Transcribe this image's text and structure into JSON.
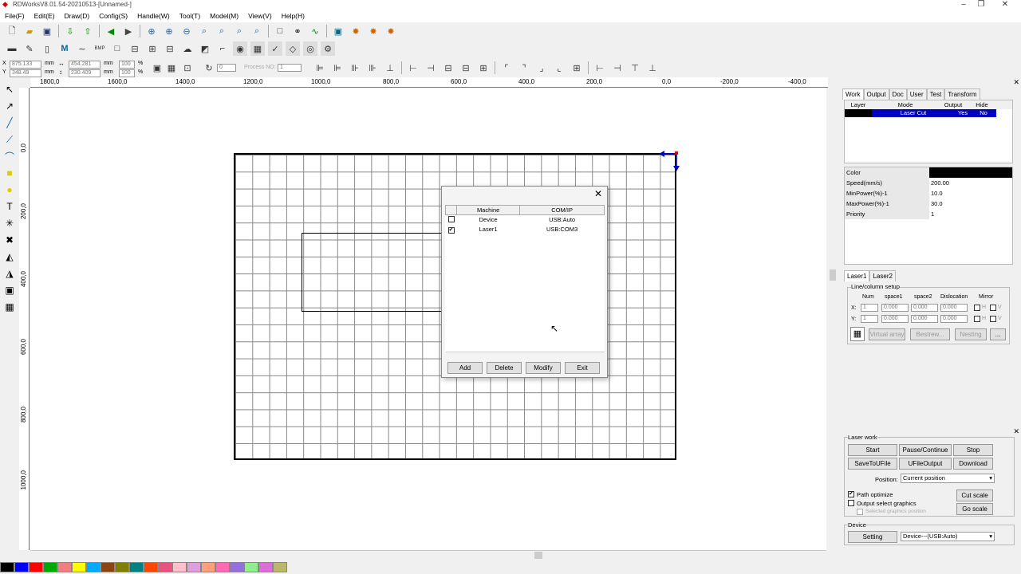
{
  "window": {
    "title": "RDWorksV8.01.54-20210513-[Unnamed-]"
  },
  "menu": [
    "File(F)",
    "Edit(E)",
    "Draw(D)",
    "Config(S)",
    "Handle(W)",
    "Tool(T)",
    "Model(M)",
    "View(V)",
    "Help(H)"
  ],
  "coords": {
    "x": "875.133",
    "y": "348.49",
    "w": "454.281",
    "h": "230.409",
    "unit": "mm",
    "sx": "100",
    "sy": "100",
    "pct": "%",
    "rot": "0",
    "process_label": "Process NO:",
    "process_no": "1"
  },
  "hruler": [
    "1800,0",
    "1600,0",
    "1400,0",
    "1200,0",
    "1000,0",
    "800,0",
    "600,0",
    "400,0",
    "200,0",
    "0,0",
    "-200,0",
    "-400,0"
  ],
  "vruler": [
    "0,0",
    "200,0",
    "400,0",
    "600,0",
    "800,0",
    "1000,0"
  ],
  "dialog": {
    "headers": [
      "Machine",
      "COM/IP"
    ],
    "rows": [
      {
        "checked": false,
        "machine": "Device",
        "comip": "USB:Auto"
      },
      {
        "checked": true,
        "machine": "Laser1",
        "comip": "USB:COM3"
      }
    ],
    "buttons": [
      "Add",
      "Delete",
      "Modify",
      "Exit"
    ],
    "check_mark": "✔"
  },
  "right": {
    "tabs": [
      "Work",
      "Output",
      "Doc",
      "User",
      "Test",
      "Transform"
    ],
    "layer_headers": [
      "Layer",
      "Mode",
      "Output",
      "Hide"
    ],
    "layer_row": {
      "mode": "Laser Cut",
      "output": "Yes",
      "hide": "No"
    },
    "props": [
      [
        "Color",
        ""
      ],
      [
        "Speed(mm/s)",
        "200.00"
      ],
      [
        "MinPower(%)-1",
        "10.0"
      ],
      [
        "MaxPower(%)-1",
        "30.0"
      ],
      [
        "Priority",
        "1"
      ]
    ],
    "laser_tabs": [
      "Laser1",
      "Laser2"
    ],
    "linecol": {
      "title": "Line/column setup",
      "headers": [
        "Num",
        "space1",
        "space2",
        "Dislocation",
        "Mirror"
      ],
      "x": {
        "label": "X:",
        "num": "1",
        "s1": "0.000",
        "s2": "0.000",
        "d": "0.000",
        "h": "H",
        "v": "V"
      },
      "y": {
        "label": "Y:",
        "num": "1",
        "s1": "0.000",
        "s2": "0.000",
        "d": "0.000",
        "h": "H",
        "v": "V"
      },
      "buttons": [
        "Virtual array",
        "Bestrew...",
        "Nesting",
        "..."
      ]
    }
  },
  "laserwork": {
    "title": "Laser work",
    "buttons": [
      "Start",
      "Pause/Continue",
      "Stop",
      "SaveToUFile",
      "UFileOutput",
      "Download"
    ],
    "position_label": "Position:",
    "position_value": "Current position",
    "path_optimize": "Path optimize",
    "output_select": "Output select graphics",
    "selected_pos": "Selected graphics position",
    "cut_scale": "Cut scale",
    "go_scale": "Go scale",
    "device_title": "Device",
    "setting": "Setting",
    "device_value": "Device---(USB:Auto)"
  },
  "palette": [
    "#000000",
    "#0000ff",
    "#ff0000",
    "#00aa00",
    "#f08080",
    "#ffff00",
    "#00aaff",
    "#8b4513",
    "#808000",
    "#008080",
    "#ff4500",
    "#e75480",
    "#ffc0cb",
    "#dda0dd",
    "#ffa07a",
    "#ff69b4",
    "#9370db",
    "#90ee90",
    "#da70d6",
    "#bdb76b"
  ]
}
